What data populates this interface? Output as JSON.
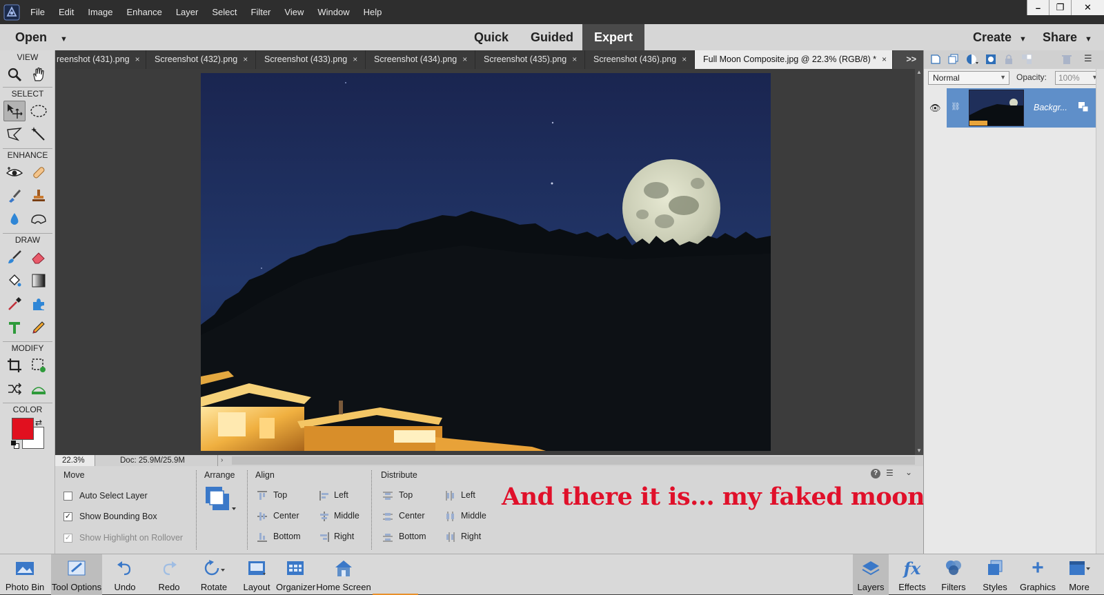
{
  "menubar": {
    "items": [
      "File",
      "Edit",
      "Image",
      "Enhance",
      "Layer",
      "Select",
      "Filter",
      "View",
      "Window",
      "Help"
    ],
    "window_controls": [
      "–",
      "❐",
      "✕"
    ]
  },
  "modebar": {
    "open_label": "Open",
    "modes": [
      "Quick",
      "Guided",
      "Expert"
    ],
    "create_label": "Create",
    "share_label": "Share"
  },
  "toolbox": {
    "sections": {
      "view": "VIEW",
      "select": "SELECT",
      "enhance": "ENHANCE",
      "draw": "DRAW",
      "modify": "MODIFY",
      "color": "COLOR"
    },
    "foreground_color": "#e1101f",
    "background_color": "#ffffff"
  },
  "tabs": [
    {
      "label": "reenshot (431).png",
      "close": "×"
    },
    {
      "label": "Screenshot (432).png",
      "close": "×"
    },
    {
      "label": "Screenshot (433).png",
      "close": "×"
    },
    {
      "label": "Screenshot (434).png",
      "close": "×"
    },
    {
      "label": "Screenshot (435).png",
      "close": "×"
    },
    {
      "label": "Screenshot (436).png",
      "close": "×"
    },
    {
      "label": "Full Moon Composite.jpg @ 22.3% (RGB/8) *",
      "close": "×"
    }
  ],
  "tabs_overflow": ">>",
  "status": {
    "zoom": "22.3%",
    "doc": "Doc: 25.9M/25.9M"
  },
  "tool_options": {
    "move_label": "Move",
    "auto_select_layer": "Auto Select Layer",
    "show_bounding_box": "Show Bounding Box",
    "show_highlight": "Show Highlight on Rollover",
    "arrange_label": "Arrange",
    "align_label": "Align",
    "align": {
      "top": "Top",
      "center": "Center",
      "bottom": "Bottom",
      "left": "Left",
      "middle": "Middle",
      "right": "Right"
    },
    "distribute_label": "Distribute",
    "distribute": {
      "top": "Top",
      "center": "Center",
      "bottom": "Bottom",
      "left": "Left",
      "middle": "Middle",
      "right": "Right"
    },
    "help": "?"
  },
  "annotation": "And there it is... my faked moonrise!",
  "layers_panel": {
    "blend_mode": "Normal",
    "opacity_label": "Opacity:",
    "opacity_value": "100%",
    "layer_name": "Backgr..."
  },
  "bottombar": {
    "left": [
      "Photo Bin",
      "Tool Options",
      "Undo",
      "Redo",
      "Rotate",
      "Layout",
      "Organizer",
      "Home Screen"
    ],
    "right": [
      "Layers",
      "Effects",
      "Filters",
      "Styles",
      "Graphics",
      "More"
    ]
  },
  "colors": {
    "accent_blue": "#5f8fc9",
    "annotation_red": "#e0102a"
  }
}
